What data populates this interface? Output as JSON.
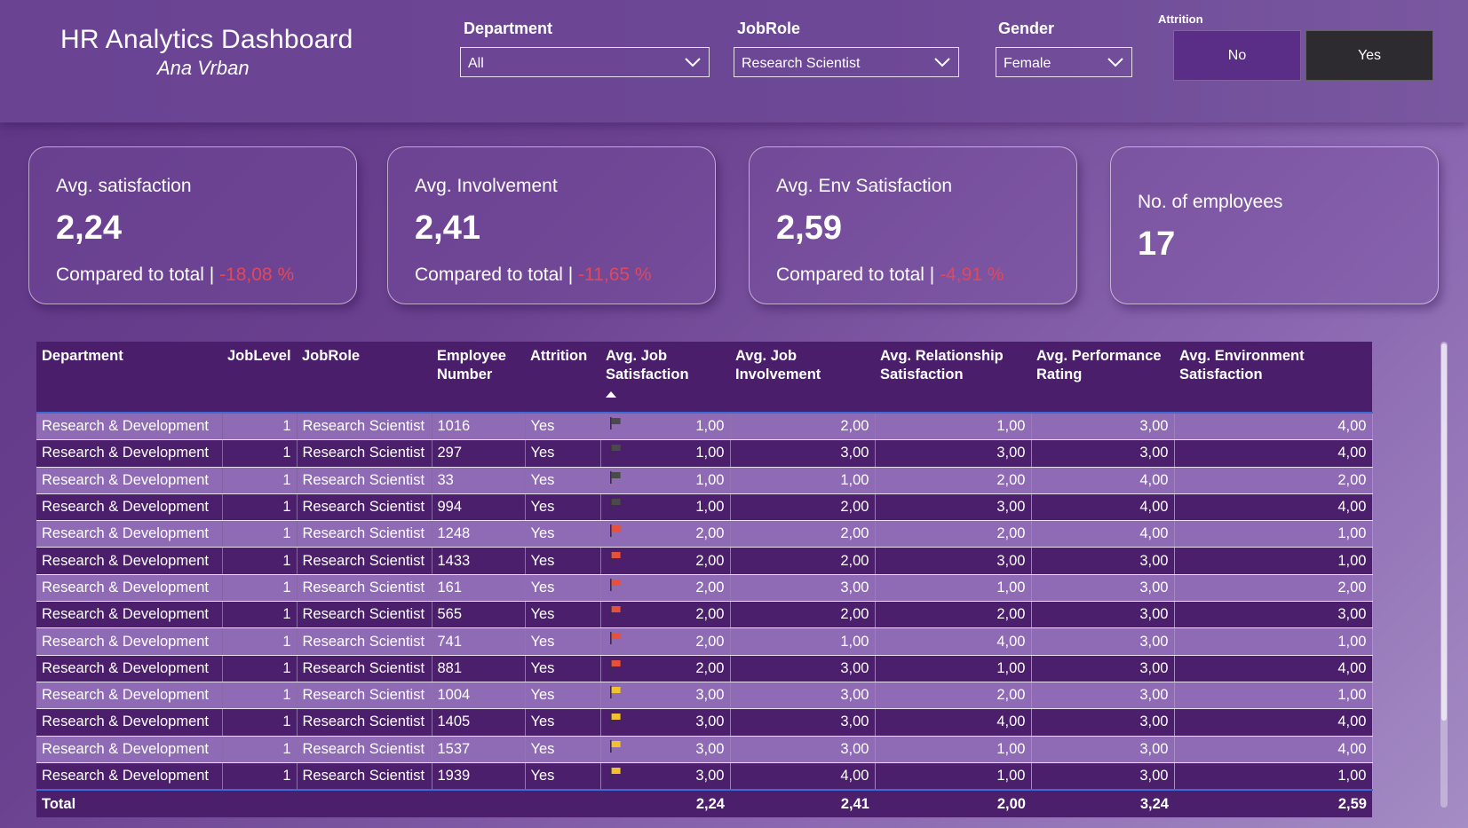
{
  "header": {
    "title": "HR Analytics Dashboard",
    "subtitle": "Ana Vrban"
  },
  "filters": {
    "department": {
      "label": "Department",
      "value": "All"
    },
    "jobrole": {
      "label": "JobRole",
      "value": "Research Scientist"
    },
    "gender": {
      "label": "Gender",
      "value": "Female"
    },
    "attrition": {
      "label": "Attrition",
      "options": [
        "No",
        "Yes"
      ],
      "selected": "Yes"
    }
  },
  "cards": [
    {
      "title": "Avg. satisfaction",
      "value": "2,24",
      "compare_label": "Compared to total |",
      "compare_value": "-18,08 %"
    },
    {
      "title": "Avg. Involvement",
      "value": "2,41",
      "compare_label": "Compared to total |",
      "compare_value": "-11,65 %"
    },
    {
      "title": "Avg. Env Satisfaction",
      "value": "2,59",
      "compare_label": "Compared to total |",
      "compare_value": "-4,91 %"
    },
    {
      "title": "No. of employees",
      "value": "17"
    }
  ],
  "table": {
    "columns": [
      "Department",
      "JobLevel",
      "JobRole",
      "Employee Number",
      "Attrition",
      "Avg. Job Satisfaction",
      "Avg. Job Involvement",
      "Avg. Relationship Satisfaction",
      "Avg. Performance Rating",
      "Avg. Environment Satisfaction"
    ],
    "flag_colors": {
      "dark": "#4a4a4a",
      "red": "#e8503a",
      "yellow": "#f2c12e"
    },
    "rows": [
      [
        "Research & Development",
        "1",
        "Research Scientist",
        "1016",
        "Yes",
        "dark",
        "1,00",
        "2,00",
        "1,00",
        "3,00",
        "4,00"
      ],
      [
        "Research & Development",
        "1",
        "Research Scientist",
        "297",
        "Yes",
        "dark",
        "1,00",
        "3,00",
        "3,00",
        "3,00",
        "4,00"
      ],
      [
        "Research & Development",
        "1",
        "Research Scientist",
        "33",
        "Yes",
        "dark",
        "1,00",
        "1,00",
        "2,00",
        "4,00",
        "2,00"
      ],
      [
        "Research & Development",
        "1",
        "Research Scientist",
        "994",
        "Yes",
        "dark",
        "1,00",
        "2,00",
        "3,00",
        "4,00",
        "4,00"
      ],
      [
        "Research & Development",
        "1",
        "Research Scientist",
        "1248",
        "Yes",
        "red",
        "2,00",
        "2,00",
        "2,00",
        "4,00",
        "1,00"
      ],
      [
        "Research & Development",
        "1",
        "Research Scientist",
        "1433",
        "Yes",
        "red",
        "2,00",
        "2,00",
        "3,00",
        "3,00",
        "1,00"
      ],
      [
        "Research & Development",
        "1",
        "Research Scientist",
        "161",
        "Yes",
        "red",
        "2,00",
        "3,00",
        "1,00",
        "3,00",
        "2,00"
      ],
      [
        "Research & Development",
        "1",
        "Research Scientist",
        "565",
        "Yes",
        "red",
        "2,00",
        "2,00",
        "2,00",
        "3,00",
        "3,00"
      ],
      [
        "Research & Development",
        "1",
        "Research Scientist",
        "741",
        "Yes",
        "red",
        "2,00",
        "1,00",
        "4,00",
        "3,00",
        "1,00"
      ],
      [
        "Research & Development",
        "1",
        "Research Scientist",
        "881",
        "Yes",
        "red",
        "2,00",
        "3,00",
        "1,00",
        "3,00",
        "4,00"
      ],
      [
        "Research & Development",
        "1",
        "Research Scientist",
        "1004",
        "Yes",
        "yellow",
        "3,00",
        "3,00",
        "2,00",
        "3,00",
        "1,00"
      ],
      [
        "Research & Development",
        "1",
        "Research Scientist",
        "1405",
        "Yes",
        "yellow",
        "3,00",
        "3,00",
        "4,00",
        "3,00",
        "4,00"
      ],
      [
        "Research & Development",
        "1",
        "Research Scientist",
        "1537",
        "Yes",
        "yellow",
        "3,00",
        "3,00",
        "1,00",
        "3,00",
        "4,00"
      ],
      [
        "Research & Development",
        "1",
        "Research Scientist",
        "1939",
        "Yes",
        "yellow",
        "3,00",
        "4,00",
        "1,00",
        "3,00",
        "1,00"
      ]
    ],
    "total": {
      "label": "Total",
      "values": [
        "2,24",
        "2,41",
        "2,00",
        "3,24",
        "2,59"
      ]
    }
  }
}
